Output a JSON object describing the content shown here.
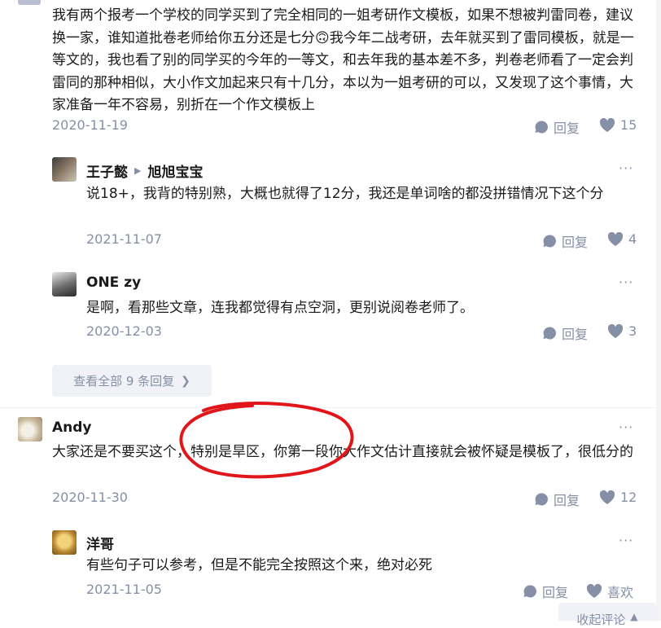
{
  "comment1": {
    "text": "我有两个报考一个学校的同学买到了完全相同的一姐考研作文模板，如果不想被判雷同卷，建议换一家，谁知道批卷老师给你五分还是七分🙃我今年二战考研，去年就买到了雷同模板，就是一等文的，我也看了别的同学买的今年的一等文，和去年我的基本差不多，判卷老师看了一定会判雷同的那种相似，大小作文加起来只有十几分，本以为一姐考研的可以，又发现了这个事情，大家准备一年不容易，别折在一个作文模板上",
    "date": "2020-11-19",
    "reply_label": "回复",
    "likes": "15"
  },
  "reply1": {
    "author": "王子懿",
    "reply_to": "旭旭宝宝",
    "text": "说18+，我背的特别熟，大概也就得了12分，我还是单词啥的都没拼错情况下这个分",
    "date": "2021-11-07",
    "reply_label": "回复",
    "likes": "4"
  },
  "reply2": {
    "author": "ONE zy",
    "text": "是啊，看那些文章，连我都觉得有点空洞，更别说阅卷老师了。",
    "date": "2020-12-03",
    "reply_label": "回复",
    "likes": "3"
  },
  "view_all": {
    "label": "查看全部 9 条回复"
  },
  "comment2": {
    "author": "Andy",
    "text": "大家还是不要买这个，特别是旱区，你第一段你大作文估计直接就会被怀疑是模板了，很低分的",
    "date": "2020-11-30",
    "reply_label": "回复",
    "likes": "12"
  },
  "reply3": {
    "author": "洋哥",
    "text": "有些句子可以参考，但是不能完全按照这个来，绝对必死",
    "date": "2021-11-05",
    "reply_label": "回复",
    "like_label": "喜欢"
  },
  "collapse": {
    "label": "收起评论"
  },
  "more_glyph": "···",
  "colors": {
    "accent": "#8590a6",
    "annotation": "#e0161b"
  }
}
